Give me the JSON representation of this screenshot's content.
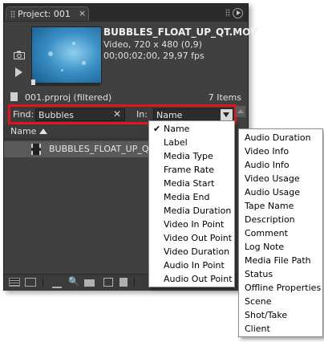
{
  "panel": {
    "tab_title": "Project: 001",
    "tab_close": "×"
  },
  "clip": {
    "name": "BUBBLES_FLOAT_UP_QT.MOV",
    "info_line1": "Video, 720 x 480 (0,9)",
    "info_line2": "00;00;02;00, 29,97 fps"
  },
  "project": {
    "name": "001.prproj (filtered)",
    "item_count": "7 Items"
  },
  "find": {
    "label": "Find:",
    "value": "Bubbles",
    "clear": "✕",
    "in_label": "In:",
    "in_value": "Name"
  },
  "list": {
    "column_name": "Name",
    "row_name": "BUBBLES_FLOAT_UP_QT.M"
  },
  "toolbar": {
    "find_glyph": "🔍"
  },
  "menu_columns": [
    "Name",
    "Label",
    "Media Type",
    "Frame Rate",
    "Media Start",
    "Media End",
    "Media Duration",
    "Video In Point",
    "Video Out Point",
    "Video Duration",
    "Audio In Point",
    "Audio Out Point"
  ],
  "menu_columns_checked": "✔",
  "menu_more": [
    "Audio Duration",
    "Video Info",
    "Audio Info",
    "Video Usage",
    "Audio Usage",
    "Tape Name",
    "Description",
    "Comment",
    "Log Note",
    "Media File Path",
    "Status",
    "Offline Properties",
    "Scene",
    "Shot/Take",
    "Client"
  ]
}
